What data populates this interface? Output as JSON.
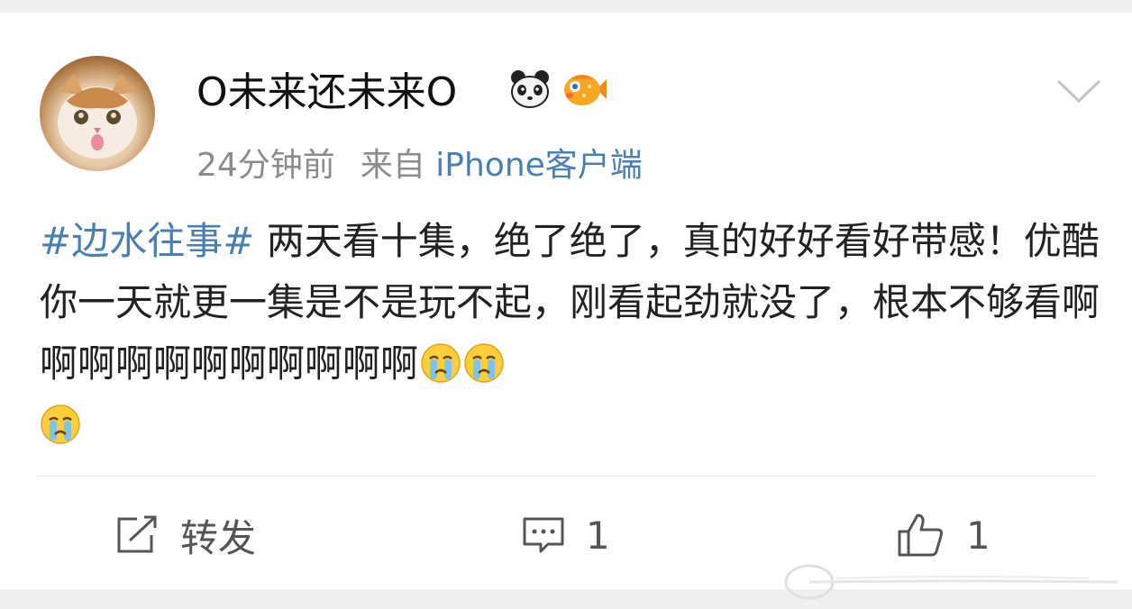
{
  "post": {
    "username": "O未来还未来O",
    "badges": [
      "panda-badge-icon",
      "fish-badge-icon"
    ],
    "time": "24分钟前",
    "source_prefix": "来自",
    "source_client": "iPhone客户端",
    "topic": "#边水往事#",
    "text": " 两天看十集，绝了绝了，真的好好看好带感！优酷你一天就更一集是不是玩不起，刚看起劲就没了，根本不够看啊啊啊啊啊啊啊啊啊啊啊",
    "emojis": [
      "crying-emoji-icon",
      "crying-emoji-icon",
      "crying-emoji-icon"
    ]
  },
  "actions": {
    "repost_label": "转发",
    "comment_count": "1",
    "like_count": "1"
  },
  "colors": {
    "link": "#4a7fb0",
    "meta": "#8c8c8c",
    "text": "#222222",
    "background": "#f0f0f0"
  }
}
